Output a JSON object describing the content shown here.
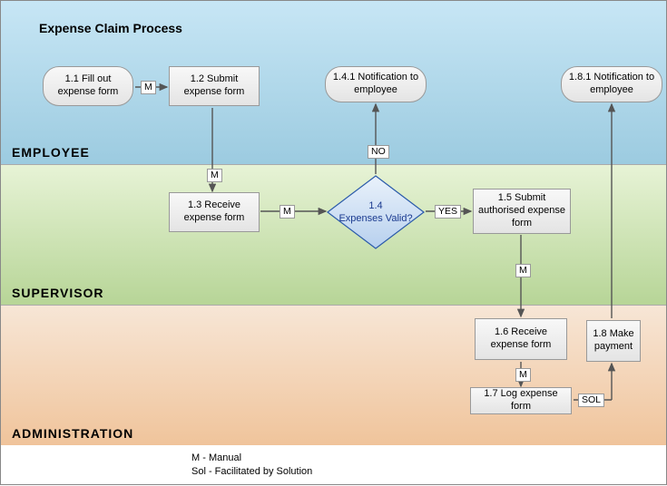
{
  "title": "Expense Claim Process",
  "lanes": {
    "employee": "EMPLOYEE",
    "supervisor": "SUPERVISOR",
    "administration": "ADMINISTRATION"
  },
  "nodes": {
    "n11": "1.1 Fill out expense form",
    "n12": "1.2 Submit expense form",
    "n141": "1.4.1 Notification to employee",
    "n181": "1.8.1 Notification to employee",
    "n13": "1.3 Receive expense form",
    "n14_num": "1.4",
    "n14_txt": "Expenses  Valid?",
    "n15": "1.5 Submit authorised expense form",
    "n16": "1.6 Receive expense form",
    "n17": "1.7 Log expense form",
    "n18": "1.8 Make payment"
  },
  "edges": {
    "m": "M",
    "yes": "YES",
    "no": "NO",
    "sol": "SOL"
  },
  "legend": {
    "line1": "M - Manual",
    "line2": "Sol - Facilitated by Solution"
  },
  "colors": {
    "employee_top": "#c7e6f5",
    "employee_bot": "#9ccbe0",
    "supervisor_top": "#e7f3d6",
    "supervisor_bot": "#b7d597",
    "admin_top": "#f7e6d6",
    "admin_bot": "#f0c49b"
  }
}
